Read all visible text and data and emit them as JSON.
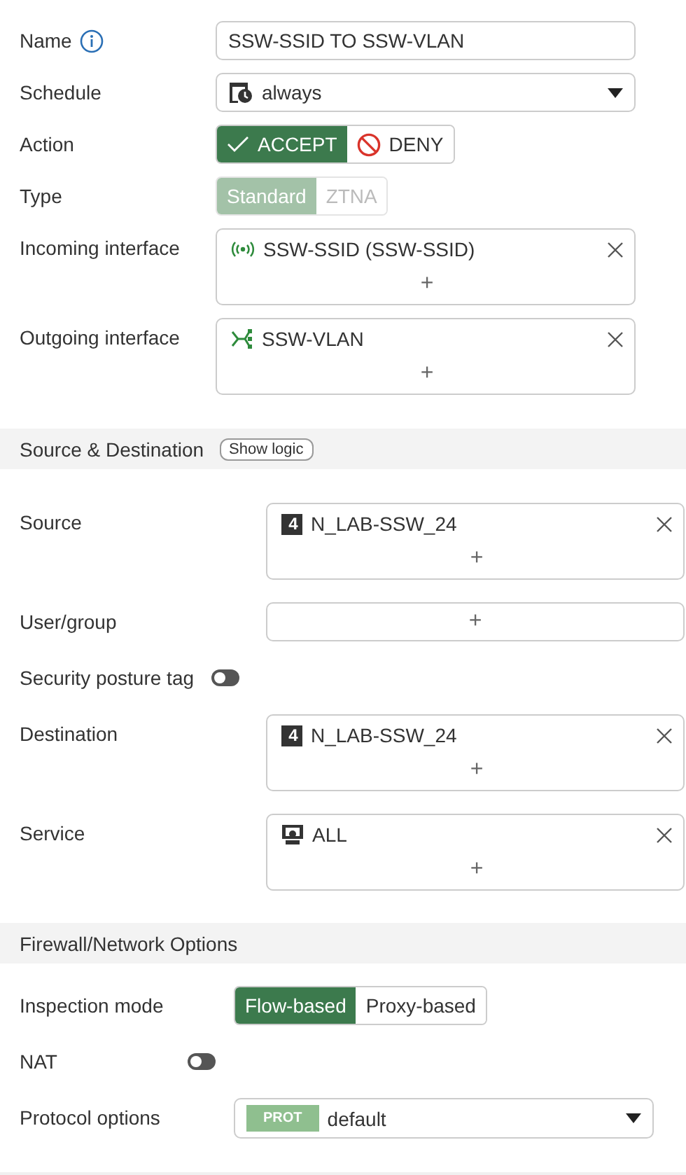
{
  "sections": [
    {
      "rows": [
        {
          "kind": "input",
          "label": "Name",
          "info": true,
          "value": "SSW-SSID TO SSW-VLAN"
        },
        {
          "kind": "select",
          "label": "Schedule",
          "value": "always"
        },
        {
          "kind": "segmented",
          "label": "Action",
          "disabled": false,
          "options": [
            {
              "label": "ACCEPT",
              "kind": "accept",
              "selected": true
            },
            {
              "label": "DENY",
              "kind": "deny",
              "selected": false
            }
          ]
        },
        {
          "kind": "segmented",
          "label": "Type",
          "disabled": true,
          "options": [
            {
              "label": "Standard",
              "selected": true
            },
            {
              "label": "ZTNA",
              "selected": false
            }
          ]
        },
        {
          "kind": "multi",
          "label": "Incoming interface",
          "items": [
            {
              "label": "SSW-SSID (SSW-SSID)",
              "kind": "wireless"
            }
          ],
          "add": "+"
        },
        {
          "kind": "multi",
          "label": "Outgoing interface",
          "items": [
            {
              "label": "SSW-VLAN",
              "kind": "vlan"
            }
          ],
          "add": "+"
        }
      ]
    },
    {
      "title": "Source & Destination",
      "button": "Show logic",
      "rows": [
        {
          "kind": "multi",
          "label": "Source",
          "items": [
            {
              "label": "N_LAB-SSW_24",
              "kind": "address",
              "badge": "4"
            }
          ],
          "add": "+"
        },
        {
          "kind": "multi",
          "label": "User/group",
          "items": [],
          "add": "+"
        },
        {
          "kind": "toggle",
          "label": "Security posture tag",
          "on": false
        },
        {
          "kind": "multi",
          "label": "Destination",
          "items": [
            {
              "label": "N_LAB-SSW_24",
              "kind": "address",
              "badge": "4"
            }
          ],
          "add": "+"
        },
        {
          "kind": "multi",
          "label": "Service",
          "items": [
            {
              "label": "ALL",
              "kind": "service"
            }
          ],
          "add": "+"
        }
      ]
    },
    {
      "title": "Firewall/Network Options",
      "rows": [
        {
          "kind": "segmented",
          "label": "Inspection mode",
          "disabled": false,
          "options": [
            {
              "label": "Flow-based",
              "selected": true
            },
            {
              "label": "Proxy-based",
              "selected": false
            }
          ]
        },
        {
          "kind": "toggle",
          "label": "NAT",
          "on": false
        },
        {
          "kind": "select",
          "label": "Protocol options",
          "tag": "PROT",
          "value": "default"
        }
      ]
    }
  ]
}
